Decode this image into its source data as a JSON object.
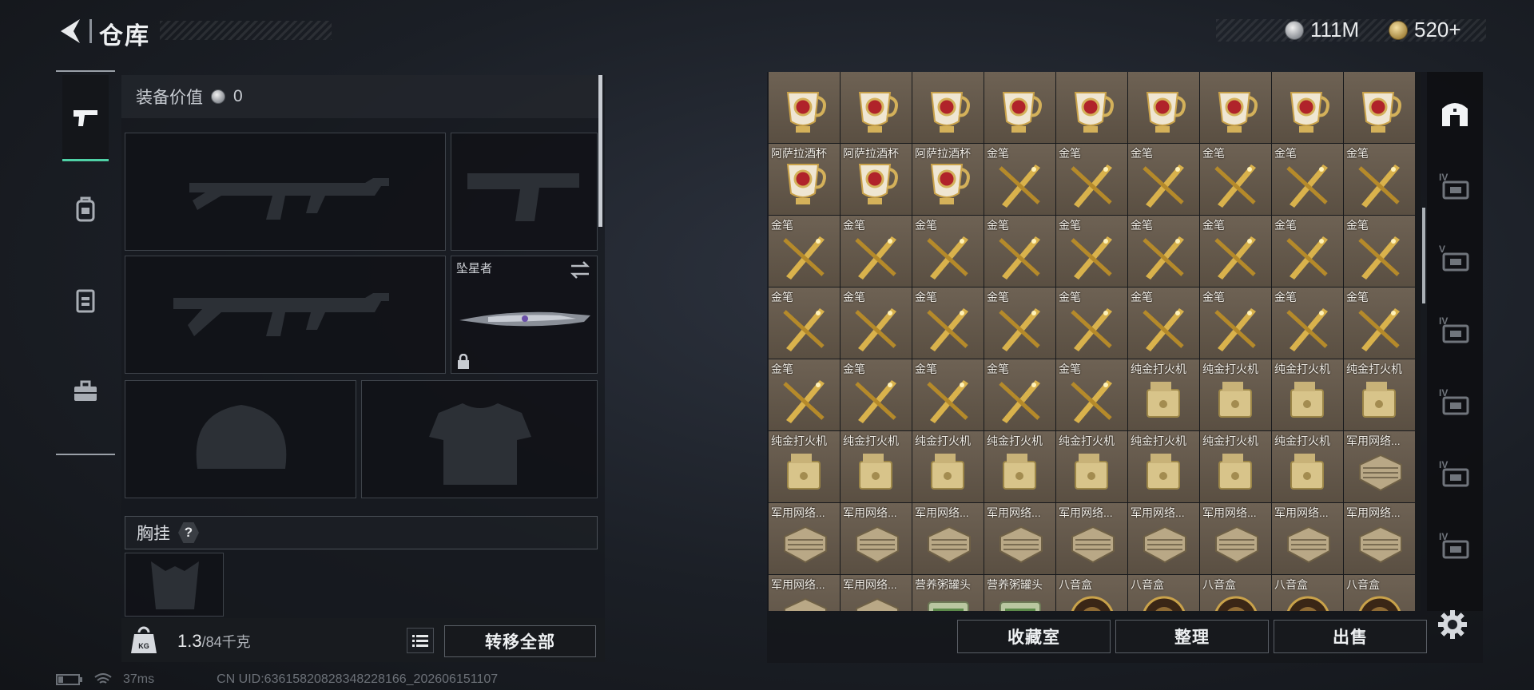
{
  "header": {
    "title": "仓库"
  },
  "currency": {
    "silver": "111M",
    "gold": "520+"
  },
  "equipment": {
    "value_label": "装备价值",
    "value": "0",
    "melee_name": "坠星者",
    "chest_rig_label": "胸挂",
    "chest_rig_help": "?"
  },
  "capacity": {
    "current": "1.3",
    "max": "/84千克",
    "icon_label": "KG"
  },
  "buttons": {
    "transfer_all": "转移全部",
    "collection": "收藏室",
    "organize": "整理",
    "sell": "出售"
  },
  "status": {
    "ping": "37ms",
    "uid": "CN UID:6361582082834822816​6_202606151107"
  },
  "inventory": {
    "items": [
      {
        "name": "",
        "type": "cup"
      },
      {
        "name": "",
        "type": "cup"
      },
      {
        "name": "",
        "type": "cup"
      },
      {
        "name": "",
        "type": "cup"
      },
      {
        "name": "",
        "type": "cup"
      },
      {
        "name": "",
        "type": "cup"
      },
      {
        "name": "",
        "type": "cup"
      },
      {
        "name": "",
        "type": "cup"
      },
      {
        "name": "",
        "type": "cup"
      },
      {
        "name": "阿萨拉酒杯",
        "type": "cup"
      },
      {
        "name": "阿萨拉酒杯",
        "type": "cup"
      },
      {
        "name": "阿萨拉酒杯",
        "type": "cup"
      },
      {
        "name": "金笔",
        "type": "pen"
      },
      {
        "name": "金笔",
        "type": "pen"
      },
      {
        "name": "金笔",
        "type": "pen"
      },
      {
        "name": "金笔",
        "type": "pen"
      },
      {
        "name": "金笔",
        "type": "pen"
      },
      {
        "name": "金笔",
        "type": "pen"
      },
      {
        "name": "金笔",
        "type": "pen"
      },
      {
        "name": "金笔",
        "type": "pen"
      },
      {
        "name": "金笔",
        "type": "pen"
      },
      {
        "name": "金笔",
        "type": "pen"
      },
      {
        "name": "金笔",
        "type": "pen"
      },
      {
        "name": "金笔",
        "type": "pen"
      },
      {
        "name": "金笔",
        "type": "pen"
      },
      {
        "name": "金笔",
        "type": "pen"
      },
      {
        "name": "金笔",
        "type": "pen"
      },
      {
        "name": "金笔",
        "type": "pen"
      },
      {
        "name": "金笔",
        "type": "pen"
      },
      {
        "name": "金笔",
        "type": "pen"
      },
      {
        "name": "金笔",
        "type": "pen"
      },
      {
        "name": "金笔",
        "type": "pen"
      },
      {
        "name": "金笔",
        "type": "pen"
      },
      {
        "name": "金笔",
        "type": "pen"
      },
      {
        "name": "金笔",
        "type": "pen"
      },
      {
        "name": "金笔",
        "type": "pen"
      },
      {
        "name": "金笔",
        "type": "pen"
      },
      {
        "name": "金笔",
        "type": "pen"
      },
      {
        "name": "金笔",
        "type": "pen"
      },
      {
        "name": "金笔",
        "type": "pen"
      },
      {
        "name": "金笔",
        "type": "pen"
      },
      {
        "name": "纯金打火机",
        "type": "lighter"
      },
      {
        "name": "纯金打火机",
        "type": "lighter"
      },
      {
        "name": "纯金打火机",
        "type": "lighter"
      },
      {
        "name": "纯金打火机",
        "type": "lighter"
      },
      {
        "name": "纯金打火机",
        "type": "lighter"
      },
      {
        "name": "纯金打火机",
        "type": "lighter"
      },
      {
        "name": "纯金打火机",
        "type": "lighter"
      },
      {
        "name": "纯金打火机",
        "type": "lighter"
      },
      {
        "name": "纯金打火机",
        "type": "lighter"
      },
      {
        "name": "纯金打火机",
        "type": "lighter"
      },
      {
        "name": "纯金打火机",
        "type": "lighter"
      },
      {
        "name": "纯金打火机",
        "type": "lighter"
      },
      {
        "name": "军用网络...",
        "type": "router"
      },
      {
        "name": "军用网络...",
        "type": "router"
      },
      {
        "name": "军用网络...",
        "type": "router"
      },
      {
        "name": "军用网络...",
        "type": "router"
      },
      {
        "name": "军用网络...",
        "type": "router"
      },
      {
        "name": "军用网络...",
        "type": "router"
      },
      {
        "name": "军用网络...",
        "type": "router"
      },
      {
        "name": "军用网络...",
        "type": "router"
      },
      {
        "name": "军用网络...",
        "type": "router"
      },
      {
        "name": "军用网络...",
        "type": "router"
      },
      {
        "name": "军用网络...",
        "type": "router"
      },
      {
        "name": "军用网络...",
        "type": "router"
      },
      {
        "name": "营养粥罐头",
        "type": "can"
      },
      {
        "name": "营养粥罐头",
        "type": "can"
      },
      {
        "name": "八音盒",
        "type": "musicbox"
      },
      {
        "name": "八音盒",
        "type": "musicbox"
      },
      {
        "name": "八音盒",
        "type": "musicbox"
      },
      {
        "name": "八音盒",
        "type": "musicbox"
      },
      {
        "name": "八音盒",
        "type": "musicbox"
      }
    ]
  },
  "right_tabs": [
    {
      "icon": "safehouse-icon",
      "label": ""
    },
    {
      "icon": "case-iv-icon",
      "label": "IV"
    },
    {
      "icon": "case-v-icon",
      "label": "V"
    },
    {
      "icon": "case-iv-icon",
      "label": "IV"
    },
    {
      "icon": "case-iv-icon",
      "label": "IV"
    },
    {
      "icon": "case-iv-icon",
      "label": "IV"
    },
    {
      "icon": "case-iv-icon",
      "label": "IV"
    }
  ],
  "colors": {
    "accent": "#4fd1a6",
    "item_bg": "#6a5e50"
  }
}
